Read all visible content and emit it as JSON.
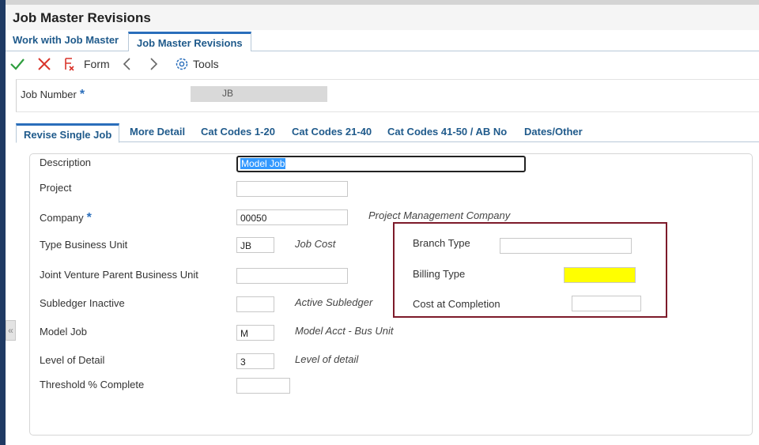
{
  "window": {
    "title": "Job Master Revisions"
  },
  "breadcrumbs": [
    {
      "label": "Work with Job Master"
    },
    {
      "label": "Job Master Revisions"
    }
  ],
  "toolbar": {
    "ok_icon": "check-icon",
    "cancel_icon": "x-icon",
    "form_label": "Form",
    "tools_label": "Tools",
    "colors": {
      "ok": "#2e9e3e",
      "cancel": "#d9342b",
      "form": "#d9342b",
      "tools": "#2a6ebb"
    }
  },
  "header": {
    "job_number_label": "Job Number",
    "required_marker": "*",
    "job_number_value": "JB"
  },
  "tabs": [
    {
      "label": "Revise Single Job"
    },
    {
      "label": "More Detail"
    },
    {
      "label": "Cat Codes 1-20"
    },
    {
      "label": "Cat Codes 21-40"
    },
    {
      "label": "Cat Codes 41-50 / AB No"
    },
    {
      "label": "Dates/Other"
    }
  ],
  "form": {
    "description": {
      "label": "Description",
      "value": "Model Job"
    },
    "project": {
      "label": "Project",
      "value": ""
    },
    "company": {
      "label": "Company",
      "value": "00050",
      "desc": "Project Management Company"
    },
    "type_bu": {
      "label": "Type Business Unit",
      "value": "JB",
      "desc": "Job Cost"
    },
    "jv_parent": {
      "label": "Joint Venture Parent Business Unit",
      "value": ""
    },
    "subledger_inactive": {
      "label": "Subledger Inactive",
      "value": "",
      "desc": "Active Subledger"
    },
    "model_job": {
      "label": "Model Job",
      "value": "M",
      "desc": "Model Acct - Bus Unit"
    },
    "level_of_detail": {
      "label": "Level of Detail",
      "value": "3",
      "desc": "Level of detail"
    },
    "threshold": {
      "label": "Threshold % Complete",
      "value": ""
    },
    "branch_type": {
      "label": "Branch Type",
      "value": ""
    },
    "billing_type": {
      "label": "Billing Type",
      "value": ""
    },
    "cost_at_completion": {
      "label": "Cost at Completion",
      "value": ""
    }
  },
  "colors": {
    "highlight_border": "#7d1a2a",
    "billing_type_fill": "#ffff00",
    "accent": "#2a6ebb"
  },
  "collapse_glyph": "«"
}
